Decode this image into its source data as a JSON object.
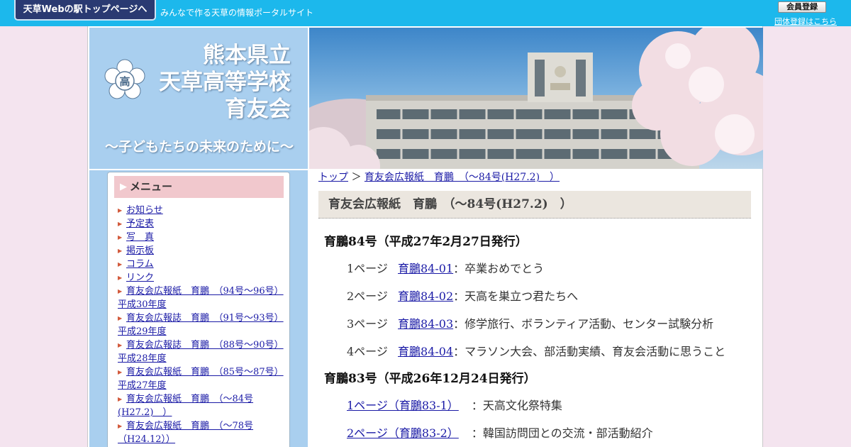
{
  "topbar": {
    "portal_button": "天草Webの駅トップページへ",
    "tagline": "みんなで作る天草の情報ポータルサイト",
    "member_button": "会員登録",
    "group_link": "団体登録はこちら"
  },
  "header": {
    "title_line1": "熊本県立",
    "title_line2": "天草高等学校",
    "title_line3": "育友会",
    "subtitle": "〜子どもたちの未来のために〜"
  },
  "sidebar": {
    "menu_title": "メニュー",
    "items": [
      {
        "label": "お知らせ",
        "after": ""
      },
      {
        "label": "予定表",
        "after": ""
      },
      {
        "label": "写　真",
        "after": ""
      },
      {
        "label": "掲示板",
        "after": ""
      },
      {
        "label": "コラム",
        "after": ""
      },
      {
        "label": "リンク",
        "after": ""
      },
      {
        "label": "育友会広報紙　育鵬　（94号～96号）平成30年度",
        "after": ""
      },
      {
        "label": "育友会広報誌　育鵬　（91号～93号）平成29年度",
        "after": ""
      },
      {
        "label": "育友会広報誌　育鵬　（88号～90号）平成28年度",
        "after": ""
      },
      {
        "label": "育友会広報紙　育鵬　（85号～87号）平成27年度",
        "after": ""
      },
      {
        "label": "育友会広報紙　育鵬　（～84号(H27.2)　）",
        "after": ""
      },
      {
        "label": "育友会広報紙　育鵬　（～78号（H24.12））",
        "after": ""
      }
    ]
  },
  "breadcrumb": {
    "home": "トップ",
    "separator": "＞",
    "current": "育友会広報紙　育鵬　（～84号(H27.2)　）"
  },
  "main": {
    "page_title": "育友会広報紙　育鵬　（～84号(H27.2)　）",
    "issues": [
      {
        "heading": "育鵬84号（平成27年2月27日発行）",
        "pages": [
          {
            "page": "1ページ",
            "link": "育鵬84-01",
            "desc": "：卒業おめでとう"
          },
          {
            "page": "2ページ",
            "link": "育鵬84-02",
            "desc": "：天高を巣立つ君たちへ"
          },
          {
            "page": "3ページ",
            "link": "育鵬84-03",
            "desc": "：修学旅行、ボランティア活動、センター試験分析"
          },
          {
            "page": "4ページ",
            "link": "育鵬84-04",
            "desc": "：マラソン大会、部活動実績、育友会活動に思うこと"
          }
        ]
      },
      {
        "heading": "育鵬83号（平成26年12月24日発行）",
        "pages": [
          {
            "link": "1ページ（育鵬83-1）",
            "desc": "：天高文化祭特集"
          },
          {
            "link": "2ページ（育鵬83-2）",
            "desc": "：韓国訪問団との交流・部活動紹介"
          }
        ]
      }
    ]
  },
  "colors": {
    "topbar": "#1cb8ec",
    "header_panel": "#a9cfef",
    "menu_title_bg": "#f1c8cd",
    "page_title_bg": "#ebe6df",
    "link": "#1a1aa6"
  }
}
